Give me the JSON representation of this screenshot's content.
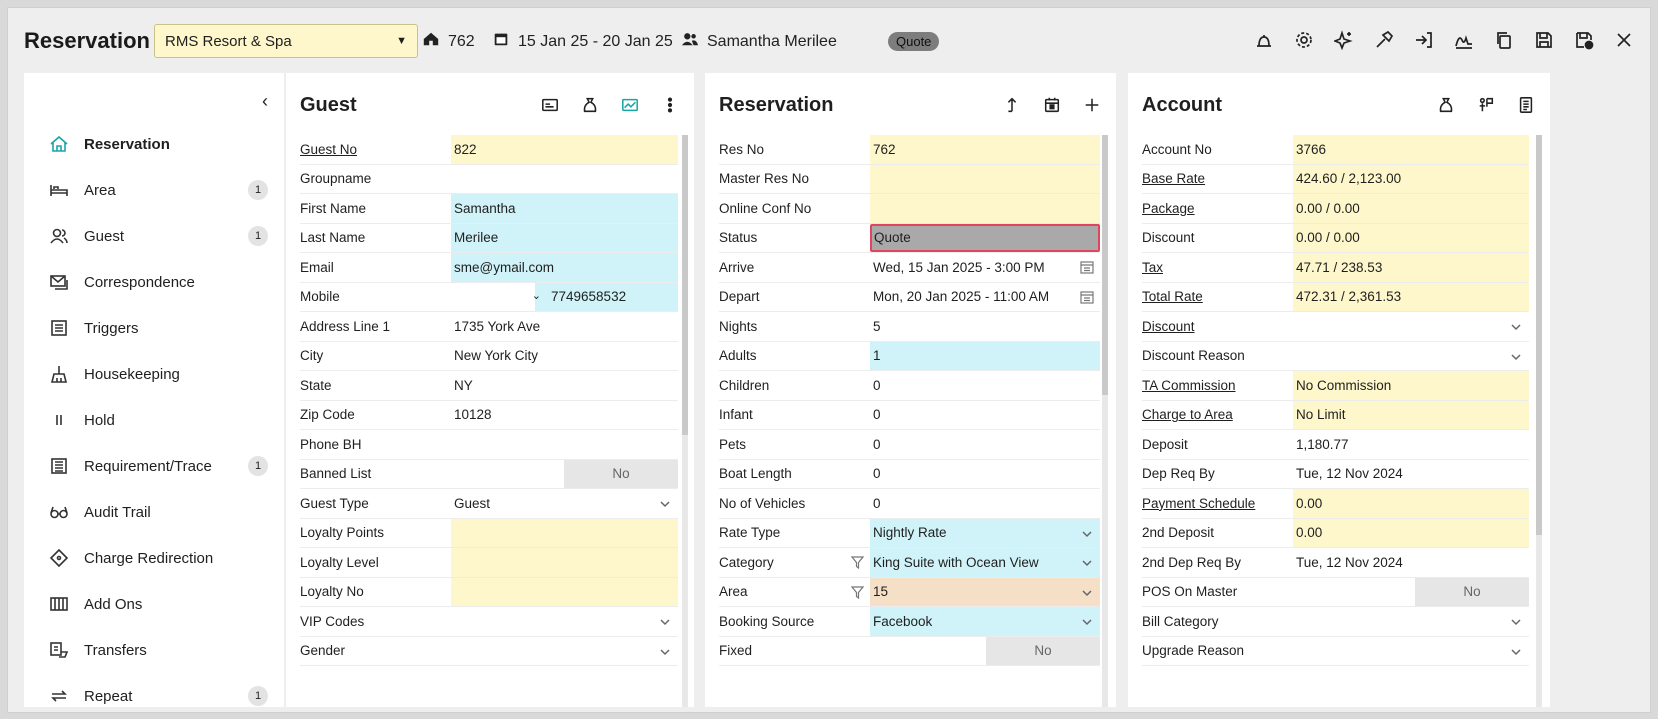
{
  "header": {
    "title": "Reservation",
    "property": "RMS Resort & Spa",
    "res_no": "762",
    "dates": "15 Jan 25  -  20 Jan 25",
    "guest": "Samantha Merilee",
    "status": "Quote",
    "toolbar_icons": [
      "bell-icon",
      "gear-icon",
      "sparkle-icon",
      "hammer-icon",
      "check-in-icon",
      "signature-icon",
      "copy-icon",
      "save-icon",
      "save-close-icon",
      "close-icon"
    ]
  },
  "sidebar": {
    "items": [
      {
        "label": "Reservation",
        "icon": "home-icon",
        "count": "",
        "active": true
      },
      {
        "label": "Area",
        "icon": "bed-icon",
        "count": "1"
      },
      {
        "label": "Guest",
        "icon": "users-icon",
        "count": "1"
      },
      {
        "label": "Correspondence",
        "icon": "envelope-icon",
        "count": ""
      },
      {
        "label": "Triggers",
        "icon": "list-icon",
        "count": ""
      },
      {
        "label": "Housekeeping",
        "icon": "housekeeping-icon",
        "count": ""
      },
      {
        "label": "Hold",
        "icon": "pause-icon",
        "count": ""
      },
      {
        "label": "Requirement/Trace",
        "icon": "checklist-icon",
        "count": "1"
      },
      {
        "label": "Audit Trail",
        "icon": "glasses-icon",
        "count": ""
      },
      {
        "label": "Charge Redirection",
        "icon": "diamond-icon",
        "count": ""
      },
      {
        "label": "Add Ons",
        "icon": "grid-icon",
        "count": ""
      },
      {
        "label": "Transfers",
        "icon": "transfer-icon",
        "count": ""
      },
      {
        "label": "Repeat",
        "icon": "repeat-icon",
        "count": "1"
      }
    ]
  },
  "guest": {
    "title": "Guest",
    "rows": [
      {
        "label": "Guest No",
        "value": "822",
        "link": true,
        "bg": "y"
      },
      {
        "label": "Groupname",
        "value": "",
        "bg": ""
      },
      {
        "label": "First Name",
        "value": "Samantha",
        "bg": "b"
      },
      {
        "label": "Last Name",
        "value": "Merilee",
        "bg": "b"
      },
      {
        "label": "Email",
        "value": "sme@ymail.com",
        "bg": "b"
      },
      {
        "label": "Mobile",
        "value": "7749658532",
        "bg": "b"
      },
      {
        "label": "Address Line 1",
        "value": "1735 York Ave",
        "bg": ""
      },
      {
        "label": "City",
        "value": "New York City",
        "bg": ""
      },
      {
        "label": "State",
        "value": "NY",
        "bg": ""
      },
      {
        "label": "Zip Code",
        "value": "10128",
        "bg": ""
      },
      {
        "label": "Phone BH",
        "value": "",
        "bg": ""
      },
      {
        "label": "Banned List",
        "value": "No",
        "bg": ""
      },
      {
        "label": "Guest Type",
        "value": "Guest",
        "bg": ""
      },
      {
        "label": "Loyalty Points",
        "value": "",
        "bg": "y"
      },
      {
        "label": "Loyalty Level",
        "value": "",
        "bg": "y"
      },
      {
        "label": "Loyalty No",
        "value": "",
        "bg": "y"
      },
      {
        "label": "VIP Codes",
        "value": "",
        "bg": ""
      },
      {
        "label": "Gender",
        "value": "",
        "bg": ""
      }
    ]
  },
  "reservation": {
    "title": "Reservation",
    "rows": [
      {
        "label": "Res No",
        "value": "762",
        "bg": "y"
      },
      {
        "label": "Master Res No",
        "value": "",
        "bg": "y"
      },
      {
        "label": "Online Conf No",
        "value": "",
        "bg": "y"
      },
      {
        "label": "Status",
        "value": "Quote",
        "bg": ""
      },
      {
        "label": "Arrive",
        "value": "Wed, 15 Jan 2025 - 3:00 PM",
        "bg": ""
      },
      {
        "label": "Depart",
        "value": "Mon, 20 Jan 2025 - 11:00 AM",
        "bg": ""
      },
      {
        "label": "Nights",
        "value": "5",
        "bg": ""
      },
      {
        "label": "Adults",
        "value": "1",
        "bg": "b"
      },
      {
        "label": "Children",
        "value": "0",
        "bg": ""
      },
      {
        "label": "Infant",
        "value": "0",
        "bg": ""
      },
      {
        "label": "Pets",
        "value": "0",
        "bg": ""
      },
      {
        "label": "Boat Length",
        "value": "0",
        "bg": ""
      },
      {
        "label": "No of Vehicles",
        "value": "0",
        "bg": ""
      },
      {
        "label": "Rate Type",
        "value": "Nightly Rate",
        "bg": "b"
      },
      {
        "label": "Category",
        "value": "King Suite with Ocean View",
        "bg": "b"
      },
      {
        "label": "Area",
        "value": "15",
        "bg": "o"
      },
      {
        "label": "Booking Source",
        "value": "Facebook",
        "bg": "b"
      },
      {
        "label": "Fixed",
        "value": "No",
        "bg": ""
      }
    ]
  },
  "account": {
    "title": "Account",
    "rows": [
      {
        "label": "Account No",
        "value": "3766",
        "link": false,
        "bg": "y"
      },
      {
        "label": "Base Rate",
        "value": "424.60 / 2,123.00",
        "link": true,
        "bg": "y"
      },
      {
        "label": "Package",
        "value": "0.00 / 0.00",
        "link": true,
        "bg": "y"
      },
      {
        "label": "Discount",
        "value": "0.00 / 0.00",
        "link": false,
        "bg": "y"
      },
      {
        "label": "Tax",
        "value": "47.71 / 238.53",
        "link": true,
        "bg": "y"
      },
      {
        "label": "Total Rate",
        "value": "472.31 / 2,361.53",
        "link": true,
        "bg": "y"
      },
      {
        "label": "Discount",
        "value": "",
        "link": true,
        "bg": ""
      },
      {
        "label": "Discount Reason",
        "value": "",
        "link": false,
        "bg": ""
      },
      {
        "label": "TA Commission",
        "value": "No Commission",
        "link": true,
        "bg": "y"
      },
      {
        "label": "Charge to Area",
        "value": "No Limit",
        "link": true,
        "bg": "y"
      },
      {
        "label": "Deposit",
        "value": "1,180.77",
        "link": false,
        "bg": ""
      },
      {
        "label": "Dep Req By",
        "value": "Tue, 12 Nov 2024",
        "link": false,
        "bg": ""
      },
      {
        "label": "Payment Schedule",
        "value": "0.00",
        "link": true,
        "bg": "y"
      },
      {
        "label": "2nd Deposit",
        "value": "0.00",
        "link": false,
        "bg": "y"
      },
      {
        "label": "2nd Dep Req By",
        "value": "Tue, 12 Nov 2024",
        "link": false,
        "bg": ""
      },
      {
        "label": "POS On Master",
        "value": "No",
        "link": false,
        "bg": ""
      },
      {
        "label": "Bill Category",
        "value": "",
        "link": false,
        "bg": ""
      },
      {
        "label": "Upgrade Reason",
        "value": "",
        "link": false,
        "bg": ""
      }
    ]
  },
  "colors": {
    "accent": "#1aa5a5",
    "yellow_field": "#fff7cc",
    "blue_field": "#cff3f8",
    "orange_field": "#f5dfc7",
    "status_border": "#e0455f"
  }
}
